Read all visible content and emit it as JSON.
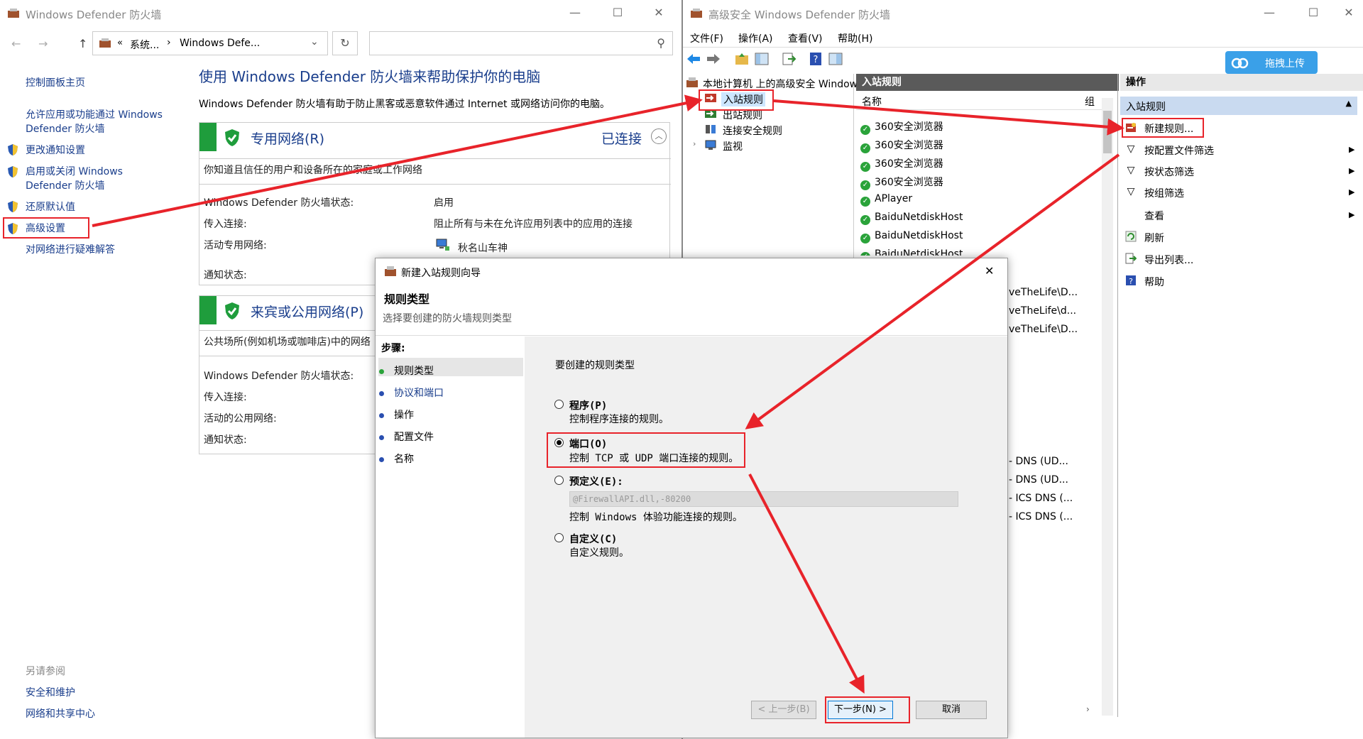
{
  "left_window": {
    "title": "Windows Defender 防火墙",
    "controls": {
      "minimize": "—",
      "maximize": "☐",
      "close": "✕"
    },
    "address": {
      "back": "←",
      "forward": "→",
      "up": "↑",
      "sep1": "«",
      "crumb1": "系统...",
      "sep2": "›",
      "crumb2": "Windows Defe...",
      "dropdown": "⌄",
      "refresh": "↻",
      "search_icon": "⚲"
    },
    "sidebar": {
      "home": "控制面板主页",
      "allow_apps": [
        "允许应用或功能通过 Windows",
        "Defender 防火墙"
      ],
      "change_notify": "更改通知设置",
      "toggle": [
        "启用或关闭 Windows",
        "Defender 防火墙"
      ],
      "restore": "还原默认值",
      "advanced": "高级设置",
      "troubleshoot": "对网络进行疑难解答",
      "see_also": "另请参阅",
      "security": "安全和维护",
      "sharing": "网络和共享中心"
    },
    "heading": "使用 Windows Defender 防火墙来帮助保护你的电脑",
    "description": "Windows Defender 防火墙有助于防止黑客或恶意软件通过 Internet 或网络访问你的电脑。",
    "private": {
      "title": "专用网络(R)",
      "status": "已连接",
      "desc": "你知道且信任的用户和设备所在的家庭或工作网络",
      "state_label": "Windows Defender 防火墙状态:",
      "state_value": "启用",
      "incoming_label": "传入连接:",
      "incoming_value": "阻止所有与未在允许应用列表中的应用的连接",
      "active_label": "活动专用网络:",
      "active_value": "秋名山车神",
      "notify_label": "通知状态:"
    },
    "public": {
      "title": "来宾或公用网络(P)",
      "desc": "公共场所(例如机场或咖啡店)中的网络",
      "state_label": "Windows Defender 防火墙状态:",
      "incoming_label": "传入连接:",
      "active_label": "活动的公用网络:",
      "notify_label": "通知状态:"
    }
  },
  "right_window": {
    "title": "高级安全 Windows Defender 防火墙",
    "controls": {
      "minimize": "—",
      "maximize": "☐",
      "close": "✕"
    },
    "menu": [
      "文件(F)",
      "操作(A)",
      "查看(V)",
      "帮助(H)"
    ],
    "upload_button": "拖拽上传",
    "tree": {
      "root": "本地计算机 上的高级安全 Windows",
      "inbound": "入站规则",
      "outbound": "出站规则",
      "connection": "连接安全规则",
      "monitor": "监视"
    },
    "rules_header": "入站规则",
    "columns": {
      "name": "名称",
      "group": "组"
    },
    "rules": [
      "360安全浏览器",
      "360安全浏览器",
      "360安全浏览器",
      "360安全浏览器",
      "APlayer",
      "BaiduNetdiskHost",
      "BaiduNetdiskHost",
      "BaiduNetdiskHost"
    ],
    "rules_partial_top": [
      "veTheLife\\D...",
      "veTheLife\\d...",
      "veTheLife\\D..."
    ],
    "rules_partial_bottom": [
      "- DNS (UD...",
      "- DNS (UD...",
      "- ICS DNS (...",
      "- ICS DNS (..."
    ],
    "actions_header": "操作",
    "actions_sub": "入站规则",
    "actions": [
      "新建规则...",
      "按配置文件筛选",
      "按状态筛选",
      "按组筛选",
      "查看",
      "刷新",
      "导出列表...",
      "帮助"
    ]
  },
  "dialog": {
    "title": "新建入站规则向导",
    "close": "✕",
    "heading": "规则类型",
    "subheading": "选择要创建的防火墙规则类型",
    "steps_label": "步骤:",
    "steps": [
      "规则类型",
      "协议和端口",
      "操作",
      "配置文件",
      "名称"
    ],
    "question": "要创建的规则类型",
    "options": [
      {
        "label": "程序(P)",
        "desc": "控制程序连接的规则。"
      },
      {
        "label": "端口(O)",
        "desc": "控制 TCP 或 UDP 端口连接的规则。"
      },
      {
        "label": "预定义(E):",
        "desc": "控制 Windows 体验功能连接的规则。"
      },
      {
        "label": "自定义(C)",
        "desc": "自定义规则。"
      }
    ],
    "predefined_value": "@FirewallAPI.dll,-80200",
    "buttons": {
      "back": "< 上一步(B)",
      "next": "下一步(N) >",
      "cancel": "取消"
    }
  },
  "colors": {
    "accent_red": "#e8232a",
    "link_blue": "#1a3e8c",
    "green": "#1f9d3c"
  }
}
